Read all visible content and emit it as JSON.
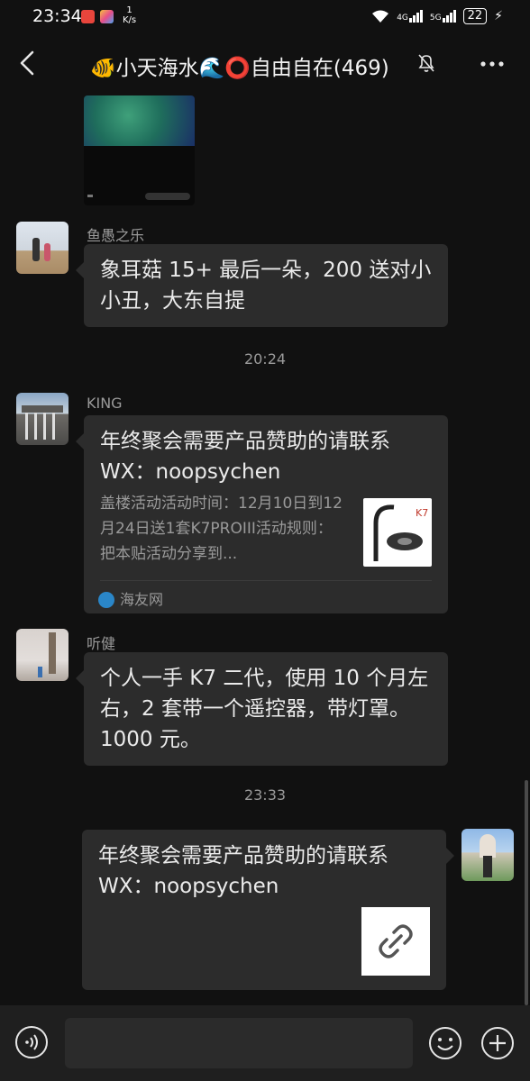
{
  "status_bar": {
    "time": "23:34",
    "net_speed_value": "1",
    "net_speed_unit": "K/s",
    "signal_1_label": "4G",
    "signal_2_label": "5G",
    "battery": "22"
  },
  "header": {
    "title": "🐠小天海水🌊⭕自由自在(469)",
    "muted": true
  },
  "messages": [
    {
      "sender": "鱼愚之乐",
      "text": "象耳菇 15+ 最后一朵，200 送对小小丑，大东自提"
    },
    {
      "timestamp": "20:24"
    },
    {
      "sender": "KING",
      "card_title": "年终聚会需要产品赞助的请联系WX：noopsychen",
      "card_desc": "盖楼活动活动时间：12月10日到12月24日送1套K7PROIII活动规则：把本贴活动分享到...",
      "card_source": "海友网",
      "thumb_text": "K7"
    },
    {
      "sender": "听健",
      "text": "个人一手 K7 二代，使用 10 个月左右，2 套带一个遥控器，带灯罩。1000 元。"
    },
    {
      "timestamp": "23:33"
    },
    {
      "sender": "me",
      "card_title": "年终聚会需要产品赞助的请联系WX：noopsychen"
    }
  ],
  "colors": {
    "background": "#111111",
    "bubble": "#2c2c2c",
    "text_secondary": "#9a9a9a"
  }
}
